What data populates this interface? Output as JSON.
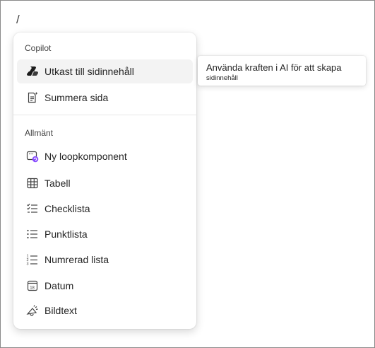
{
  "editor": {
    "slash_text": "/"
  },
  "menu": {
    "sections": [
      {
        "label": "Copilot",
        "items": [
          {
            "label": "Utkast till sidinnehåll",
            "icon": "copilot-icon",
            "active": true
          },
          {
            "label": "Summera sida",
            "icon": "summarize-page-icon"
          }
        ]
      },
      {
        "label": "Allmänt",
        "items": [
          {
            "label": "Ny loopkomponent",
            "icon": "loop-component-icon"
          },
          {
            "label": "Tabell",
            "icon": "table-icon"
          },
          {
            "label": "Checklista",
            "icon": "checklist-icon"
          },
          {
            "label": "Punktlista",
            "icon": "bullet-list-icon"
          },
          {
            "label": "Numrerad lista",
            "icon": "numbered-list-icon"
          },
          {
            "label": "Datum",
            "icon": "calendar-icon"
          },
          {
            "label": "Bildtext",
            "icon": "callout-icon"
          }
        ]
      }
    ]
  },
  "tooltip": {
    "line1": "Använda kraften i AI för att skapa",
    "line2": "sidinnehåll"
  },
  "colors": {
    "loop_accent": "#8a4fff",
    "copilot_dark": "#1b1b1b",
    "hover_bg": "#f3f3f3"
  }
}
